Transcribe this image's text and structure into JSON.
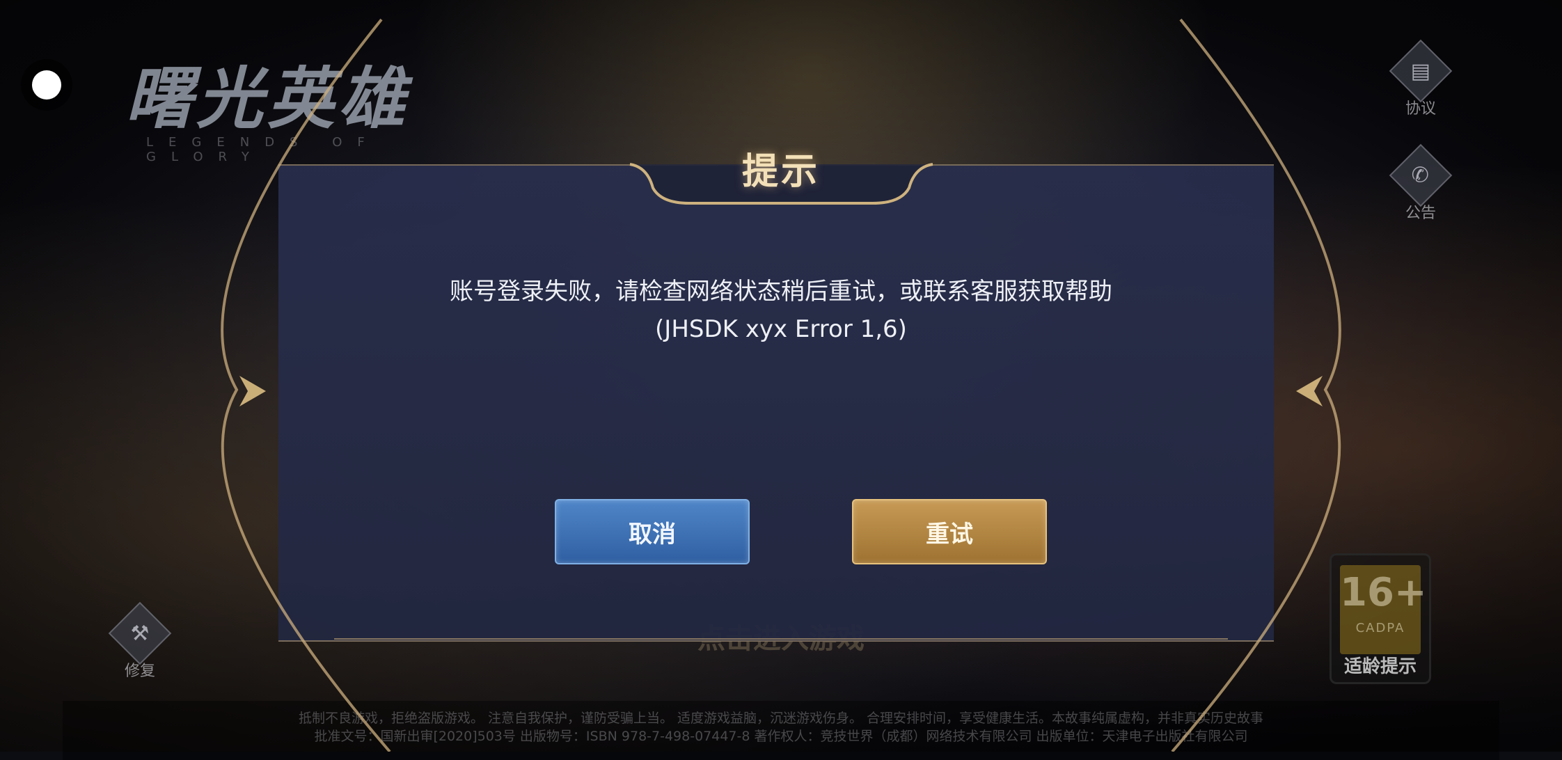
{
  "background": {
    "logo_cn": "曙光英雄",
    "logo_en": "LEGENDS OF GLORY",
    "enter_game": "点击进入游戏"
  },
  "side_buttons": {
    "agreement": {
      "label": "协议",
      "icon": "document-icon"
    },
    "announcement": {
      "label": "公告",
      "icon": "megaphone-icon"
    },
    "repair": {
      "label": "修复",
      "icon": "wrench-icon"
    }
  },
  "age_rating": {
    "number": "16+",
    "org": "CADPA",
    "label": "适龄提示"
  },
  "footer": {
    "line1": "抵制不良游戏，拒绝盗版游戏。 注意自我保护，谨防受骗上当。 适度游戏益脑，沉迷游戏伤身。 合理安排时间，享受健康生活。本故事纯属虚构，并非真实历史故事",
    "line2": "批准文号：国新出审[2020]503号  出版物号：ISBN 978-7-498-07447-8  著作权人：竞技世界（成都）网络技术有限公司  出版单位：天津电子出版社有限公司"
  },
  "dialog": {
    "title": "提示",
    "message": "账号登录失败，请检查网络状态稍后重试，或联系客服获取帮助(JHSDK xyx Error 1,6)",
    "cancel_label": "取消",
    "retry_label": "重试"
  },
  "colors": {
    "dialog_bg": "#282e4c",
    "gold_accent": "#c9a46a",
    "cancel_blue": "#3f73b6",
    "retry_gold": "#b4843f"
  }
}
